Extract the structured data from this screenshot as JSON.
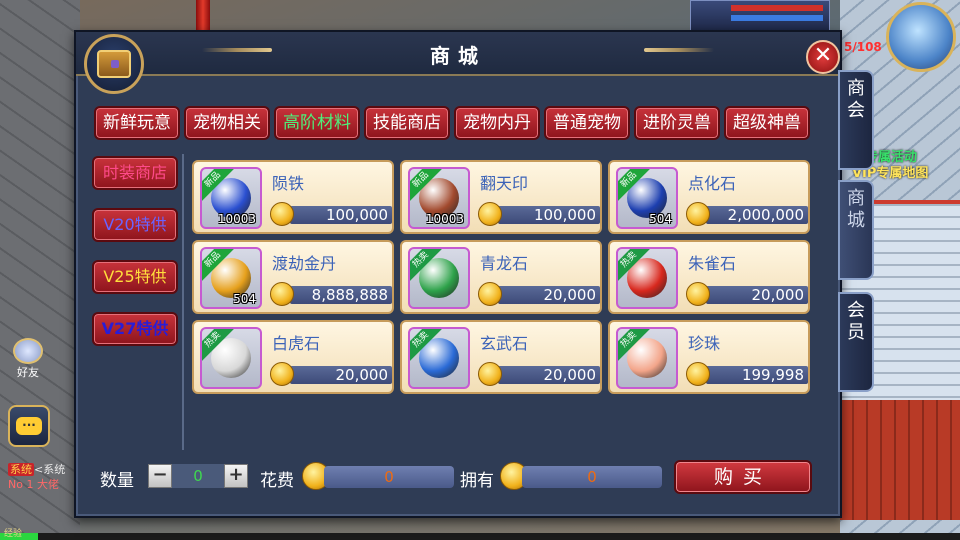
{
  "shop": {
    "title": "商城",
    "close_label": "✕",
    "category_tabs": [
      {
        "label": "新鲜玩意",
        "active": false
      },
      {
        "label": "宠物相关",
        "active": false
      },
      {
        "label": "高阶材料",
        "active": true
      },
      {
        "label": "技能商店",
        "active": false
      },
      {
        "label": "宠物内丹",
        "active": false
      },
      {
        "label": "普通宠物",
        "active": false
      },
      {
        "label": "进阶灵兽",
        "active": false
      },
      {
        "label": "超级神兽",
        "active": false
      }
    ],
    "side_tabs": [
      {
        "label": "时装商店",
        "color": "#ff4a8a"
      },
      {
        "label": "V20特供",
        "color": "#6a64ff"
      },
      {
        "label": "V25特供",
        "color": "#ffde3c"
      },
      {
        "label": "V27特供",
        "color": "#2a1dd6"
      }
    ],
    "items": [
      {
        "name": "陨铁",
        "badge": "新品",
        "qty": "10003",
        "price": "100,000",
        "gem_color": "#2a4fd0"
      },
      {
        "name": "翻天印",
        "badge": "新品",
        "qty": "10003",
        "price": "100,000",
        "gem_color": "#a24a2e"
      },
      {
        "name": "点化石",
        "badge": "新品",
        "qty": "504",
        "price": "2,000,000",
        "gem_color": "#1d3fb0"
      },
      {
        "name": "渡劫金丹",
        "badge": "新品",
        "qty": "504",
        "price": "8,888,888",
        "gem_color": "#e6a01c"
      },
      {
        "name": "青龙石",
        "badge": "热卖",
        "qty": "",
        "price": "20,000",
        "gem_color": "#2ea24a"
      },
      {
        "name": "朱雀石",
        "badge": "热卖",
        "qty": "",
        "price": "20,000",
        "gem_color": "#d8281e"
      },
      {
        "name": "白虎石",
        "badge": "热卖",
        "qty": "",
        "price": "20,000",
        "gem_color": "#d8d8d8"
      },
      {
        "name": "玄武石",
        "badge": "热卖",
        "qty": "",
        "price": "20,000",
        "gem_color": "#2a6ad6"
      },
      {
        "name": "珍珠",
        "badge": "热卖",
        "qty": "",
        "price": "199,998",
        "gem_color": "#f3a58a"
      }
    ],
    "bottom": {
      "qty_label": "数量",
      "minus": "−",
      "plus": "+",
      "qty_value": "0",
      "cost_label": "花费",
      "cost_value": "0",
      "own_label": "拥有",
      "own_value": "0",
      "buy_label": "购买"
    },
    "right_tabs": [
      {
        "label": "商\n会"
      },
      {
        "label": "商\n城"
      },
      {
        "label": "会\n员"
      }
    ]
  },
  "hud": {
    "event_line1": "票专属活动",
    "event_line2": "VIP专属地图",
    "friend_label": "好友",
    "chat_icon": "chat-icon",
    "sys_tag": "系统",
    "sys_line1": "<系统",
    "sys_line2": "No 1 大佬",
    "exp_label": "经验",
    "red_text": "5/108"
  }
}
